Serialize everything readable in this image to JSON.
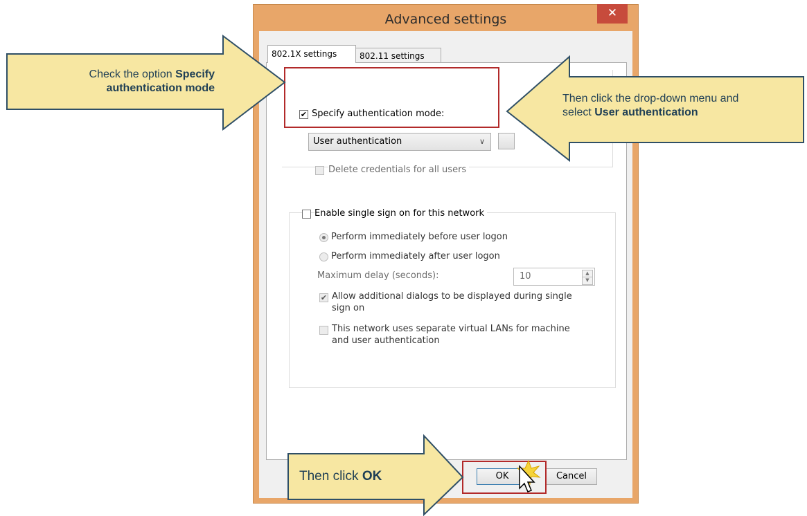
{
  "dialog": {
    "title": "Advanced settings",
    "close_glyph": "✕",
    "tabs": [
      {
        "label": "802.1X settings",
        "active": true
      },
      {
        "label": "802.11 settings",
        "active": false
      }
    ],
    "specify_auth": {
      "label": "Specify authentication mode:",
      "checked": true
    },
    "auth_mode": {
      "value": "User authentication"
    },
    "delete_credentials": {
      "label": "Delete credentials for all users",
      "checked": false
    },
    "sso": {
      "label": "Enable single sign on for this network",
      "checked": false,
      "radio_before": {
        "label": "Perform immediately before user logon",
        "selected": true
      },
      "radio_after": {
        "label": "Perform immediately after user logon",
        "selected": false
      },
      "max_delay_label": "Maximum delay (seconds):",
      "max_delay_value": "10",
      "allow_dialogs": {
        "label_line1": "Allow additional dialogs to be displayed during single",
        "label_line2": "sign on",
        "checked": true
      },
      "separate_vlans": {
        "label_line1": "This network uses separate virtual LANs for machine",
        "label_line2": "and user authentication",
        "checked": false
      }
    },
    "ok_label": "OK",
    "cancel_label": "Cancel"
  },
  "callouts": {
    "left": {
      "line1_plain": "Check the option ",
      "line1_bold": "Specify",
      "line2_bold": "authentication mode"
    },
    "right": {
      "line1_plain": "Then click the drop-down menu and",
      "line2_plain": "select ",
      "line2_bold": "User authentication"
    },
    "bottom": {
      "plain": "Then click ",
      "bold": "OK"
    }
  },
  "colors": {
    "callout_fill": "#f7e7a2",
    "callout_border": "#2f4f66",
    "highlight": "#b22a2a",
    "frame": "#e8a669",
    "close": "#c74b3c"
  },
  "icons": [
    "close-icon",
    "chevron-down-icon",
    "spin-up-icon",
    "spin-down-icon",
    "mouse-cursor-icon",
    "click-burst-icon"
  ]
}
